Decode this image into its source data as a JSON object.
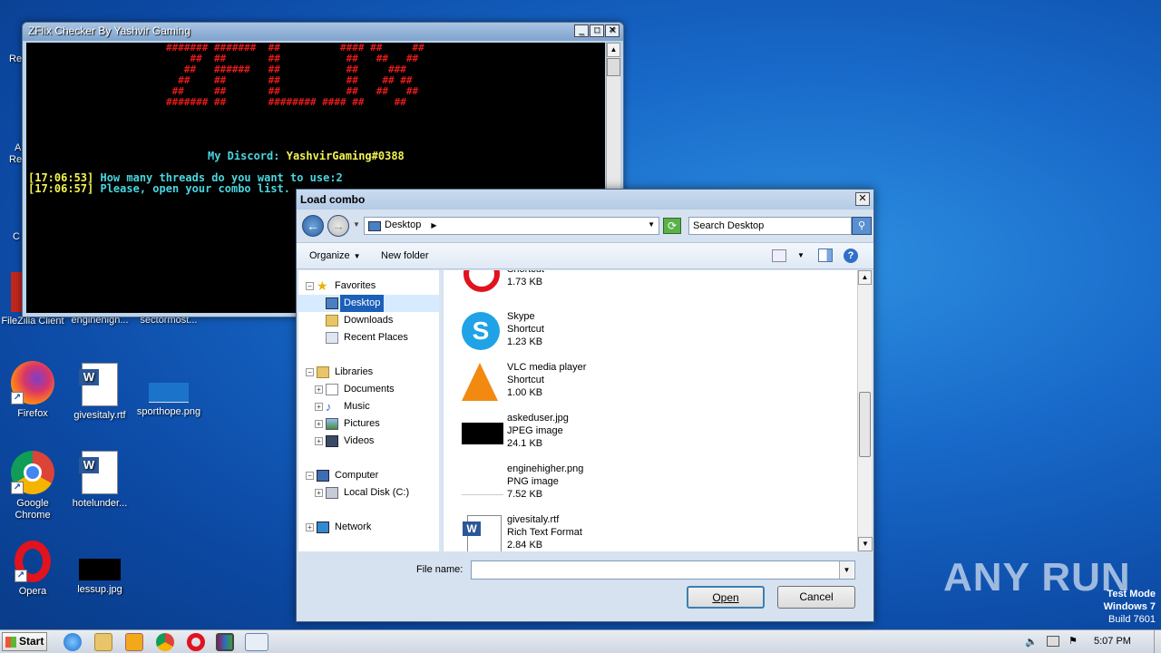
{
  "desktop": {
    "partial_labels": [
      "Re",
      "A",
      "Re",
      "C"
    ],
    "icons": [
      {
        "label": "FileZilla Client"
      },
      {
        "label": "enginehigh..."
      },
      {
        "label": "sectormost..."
      },
      {
        "label": "Firefox"
      },
      {
        "label": "givesitaly.rtf"
      },
      {
        "label": "sporthope.png"
      },
      {
        "label": "Google Chrome"
      },
      {
        "label": "hotelunder..."
      },
      {
        "label": "Opera"
      },
      {
        "label": "lessup.jpg"
      }
    ]
  },
  "console": {
    "title": "ZFlix Checker By Yashvir Gaming",
    "banner_lines": [
      "####### #######  ##          #### ##     ##",
      "    ##  ##       ##           ##   ##   ## ",
      "   ##   ######   ##           ##     ###   ",
      "  ##    ##       ##           ##    ## ##  ",
      " ##     ##       ##           ##   ##   ## ",
      "####### ##       ######## #### ##     ##"
    ],
    "discord_label": "My Discord:",
    "discord_name": "YashvirGaming#0388",
    "log": [
      {
        "ts": "[17:06:53]",
        "text": " How many threads do you want to use:2"
      },
      {
        "ts": "[17:06:57]",
        "text": " Please, open your combo list."
      }
    ]
  },
  "dialog": {
    "title": "Load combo",
    "address": "Desktop",
    "search_placeholder": "Search Desktop",
    "toolbar": {
      "organize": "Organize",
      "new_folder": "New folder"
    },
    "nav": {
      "favorites": "Favorites",
      "desktop": "Desktop",
      "downloads": "Downloads",
      "recent": "Recent Places",
      "libraries": "Libraries",
      "documents": "Documents",
      "music": "Music",
      "pictures": "Pictures",
      "videos": "Videos",
      "computer": "Computer",
      "local_disk": "Local Disk (C:)",
      "network": "Network"
    },
    "files": [
      {
        "name": "",
        "type": "Shortcut",
        "size": "1.73 KB",
        "icon": "opera-icon"
      },
      {
        "name": "Skype",
        "type": "Shortcut",
        "size": "1.23 KB",
        "icon": "skype-icon"
      },
      {
        "name": "VLC media player",
        "type": "Shortcut",
        "size": "1.00 KB",
        "icon": "vlc-icon"
      },
      {
        "name": "askeduser.jpg",
        "type": "JPEG image",
        "size": "24.1 KB",
        "icon": "image-thumb-icon"
      },
      {
        "name": "enginehigher.png",
        "type": "PNG image",
        "size": "7.52 KB",
        "icon": "image-thumb-icon"
      },
      {
        "name": "givesitaly.rtf",
        "type": "Rich Text Format",
        "size": "2.84 KB",
        "icon": "word-doc-icon"
      }
    ],
    "filename_label": "File name:",
    "filename_value": "",
    "open_label": "Open",
    "cancel_label": "Cancel"
  },
  "taskbar": {
    "start_label": "Start",
    "clock": "5:07 PM"
  },
  "watermark": {
    "brand": "ANY RUN",
    "test_mode": "Test Mode",
    "os": "Windows 7",
    "build": "Build 7601"
  }
}
